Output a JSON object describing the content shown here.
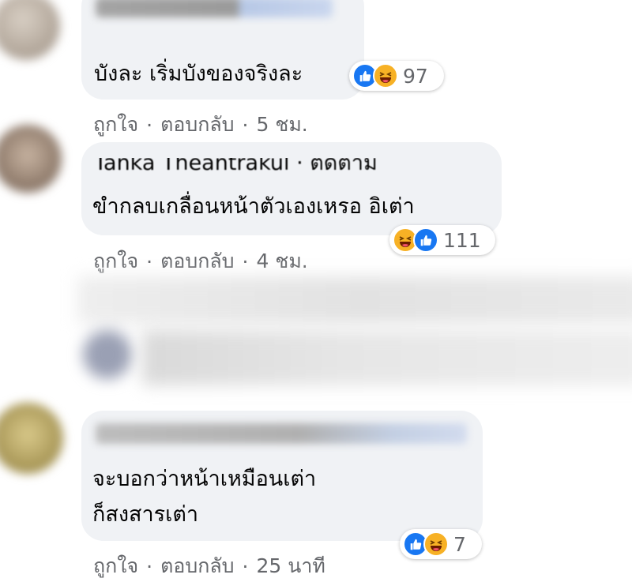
{
  "comments": [
    {
      "text": "บังละ เริ่มบังของจริงละ",
      "reactions": [
        "like-icon",
        "haha-icon"
      ],
      "reaction_count": "97",
      "like_label": "ถูกใจ",
      "reply_label": "ตอบกลับ",
      "time": "5 ชม."
    },
    {
      "author_partial": "Tanka Theantrakul · ติดตาม",
      "text": "ขำกลบเกลื่อนหน้าตัวเองเหรอ อิเต่า",
      "reactions": [
        "haha-icon",
        "like-icon"
      ],
      "reaction_count": "111",
      "like_label": "ถูกใจ",
      "reply_label": "ตอบกลับ",
      "time": "4 ชม."
    },
    {
      "text_line1": "จะบอกว่าหน้าเหมือนเต่า",
      "text_line2": "ก็สงสารเต่า",
      "reactions": [
        "like-icon",
        "haha-icon"
      ],
      "reaction_count": "7",
      "like_label": "ถูกใจ",
      "reply_label": "ตอบกลับ",
      "time": "25 นาที"
    }
  ],
  "separator": "·",
  "colors": {
    "bubble": "#f0f2f5",
    "meta_text": "#65676b",
    "like_blue": "#1877f2",
    "haha_yellow": "#f7b125",
    "link_blue": "#216fdb"
  }
}
